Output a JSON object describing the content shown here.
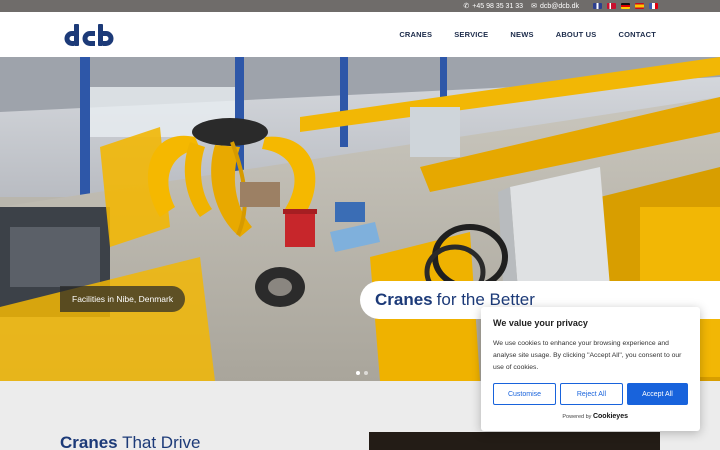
{
  "topbar": {
    "phone": "+45 98 35 31 33",
    "email": "dcb@dcb.dk",
    "flags": [
      {
        "name": "uk-flag",
        "color": "#2d3f8f"
      },
      {
        "name": "dk-flag",
        "color": "#c8102e"
      },
      {
        "name": "de-flag",
        "color": "#d8a700"
      },
      {
        "name": "es-flag",
        "color": "#c60b1e"
      },
      {
        "name": "fr-flag",
        "color": "#3c5ab0"
      }
    ]
  },
  "header": {
    "logo_text": "dcb",
    "nav": [
      "CRANES",
      "SERVICE",
      "NEWS",
      "ABOUT US",
      "CONTACT"
    ]
  },
  "hero": {
    "facility_tag": "Facilities in Nibe, Denmark",
    "title_bold": "Cranes",
    "title_rest": "for the Better",
    "slides": 2,
    "active_slide": 0
  },
  "section": {
    "title_bold": "Cranes",
    "title_rest": "That Drive"
  },
  "cookie": {
    "heading": "We value your privacy",
    "body": "We use cookies to enhance your browsing experience and analyse site usage. By clicking \"Accept All\", you consent to our use of cookies.",
    "customise": "Customise",
    "reject": "Reject All",
    "accept": "Accept All",
    "powered_by": "Powered by",
    "brand": "Cookieyes"
  },
  "colors": {
    "brand_navy": "#1c3a78",
    "accent_blue": "#1863dc",
    "crane_yellow": "#f2b705",
    "topbar_gray": "#6f6c6a"
  }
}
